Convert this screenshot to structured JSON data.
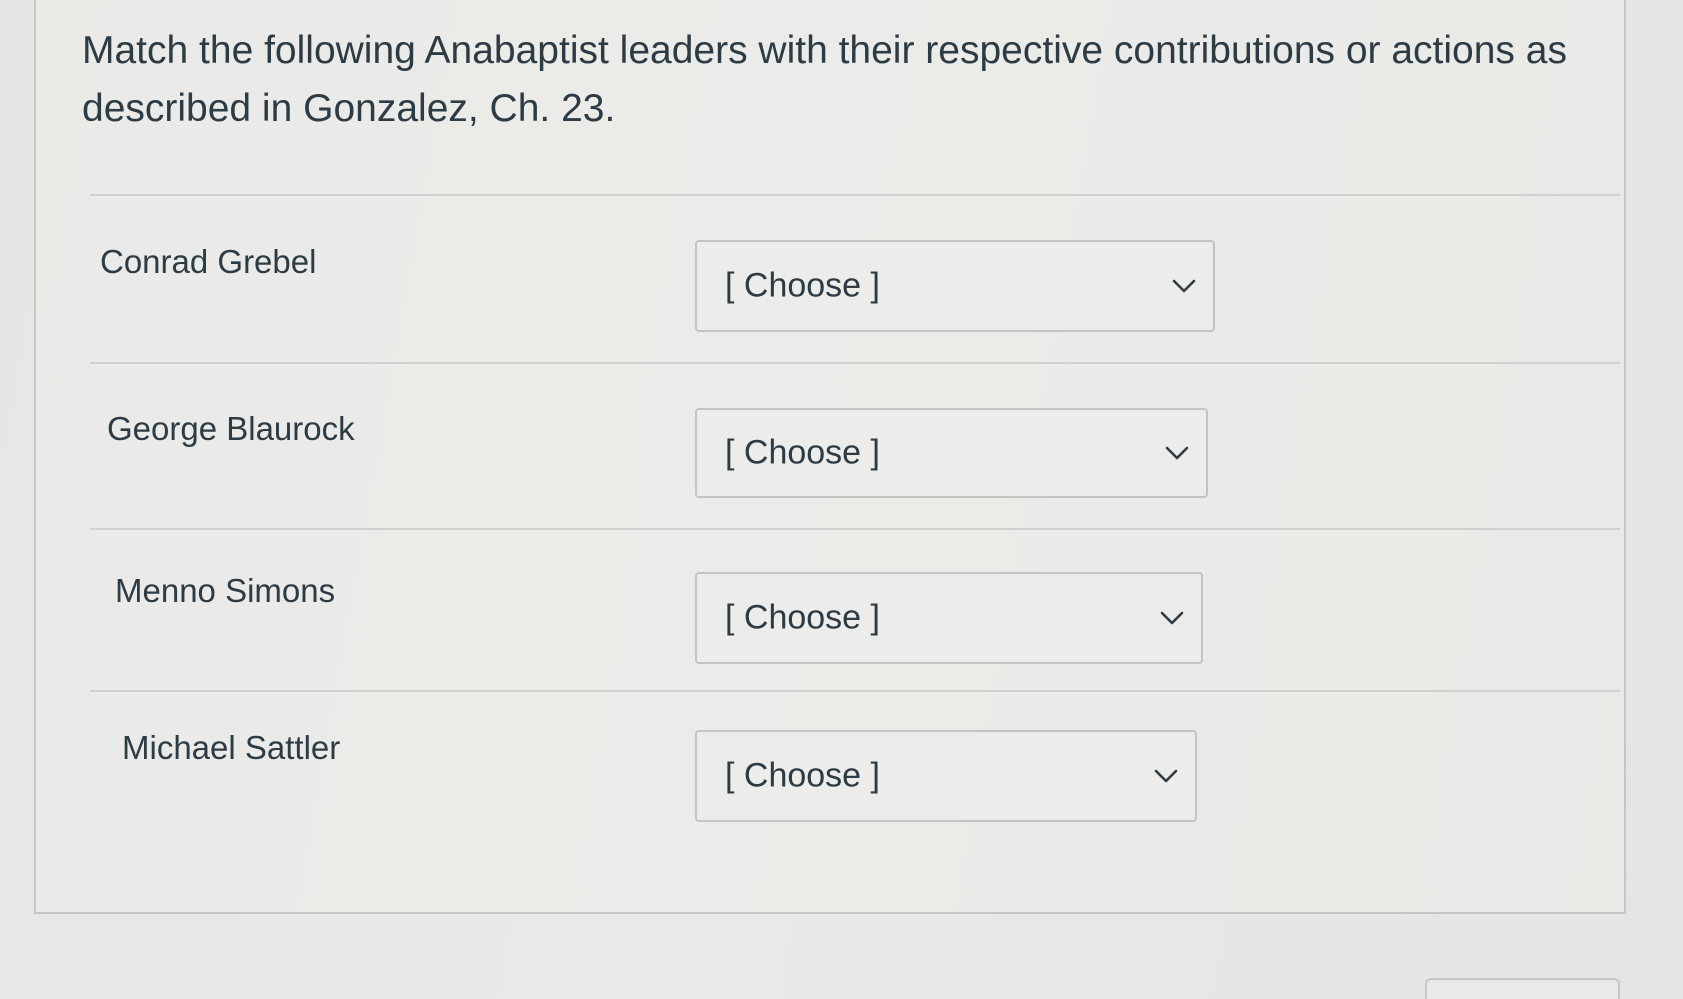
{
  "question": {
    "text": "Match the following Anabaptist leaders with their respective contributions or actions as described in Gonzalez, Ch. 23."
  },
  "matches": [
    {
      "leader": "Conrad Grebel",
      "selected": "[ Choose ]"
    },
    {
      "leader": "George Blaurock",
      "selected": "[ Choose ]"
    },
    {
      "leader": "Menno Simons",
      "selected": "[ Choose ]"
    },
    {
      "leader": "Michael Sattler",
      "selected": "[ Choose ]"
    }
  ],
  "icons": {
    "dropdown": "chevron-down-icon"
  },
  "colors": {
    "text": "#2d3b45",
    "border": "#c2c5c2",
    "background": "#e6e7e5"
  }
}
